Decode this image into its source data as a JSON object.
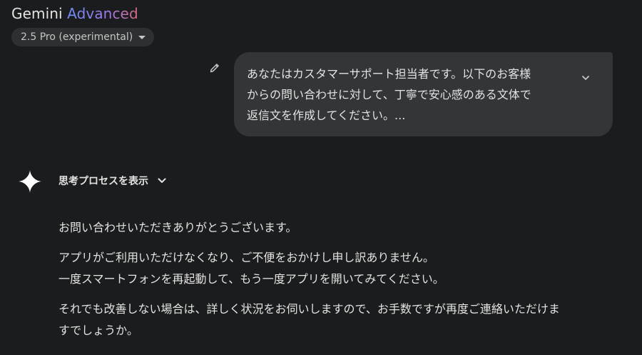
{
  "header": {
    "brand": "Gemini",
    "tier": "Advanced"
  },
  "model_selector": {
    "label": "2.5 Pro (experimental)"
  },
  "user_message": {
    "lines": [
      "あなたはカスタマーサポート担当者です。以下のお客様",
      "からの問い合わせに対して、丁寧で安心感のある文体で",
      "返信文を作成してください。..."
    ]
  },
  "thinking": {
    "label": "思考プロセスを表示"
  },
  "response": {
    "p1": "お問い合わせいただきありがとうございます。",
    "p2": [
      "アプリがご利用いただけなくなり、ご不便をおかけし申し訳ありません。",
      "一度スマートフォンを再起動して、もう一度アプリを開いてみてください。"
    ],
    "p3": [
      "それでも改善しない場合は、詳しく状況をお伺いしますので、お手数ですが再度ご連絡いただけま",
      "すでしょうか。"
    ]
  },
  "icons": {
    "edit": "pencil-icon",
    "expand": "chevron-down-icon",
    "logo": "gemini-sparkle-icon",
    "thinking_toggle": "chevron-down-icon",
    "model_caret": "caret-down-icon"
  },
  "colors": {
    "background": "#1b1c1d",
    "bubble": "#333537",
    "text": "#e3e3e3",
    "accent_gradient_start": "#6f8df5",
    "accent_gradient_end": "#d9677f"
  }
}
